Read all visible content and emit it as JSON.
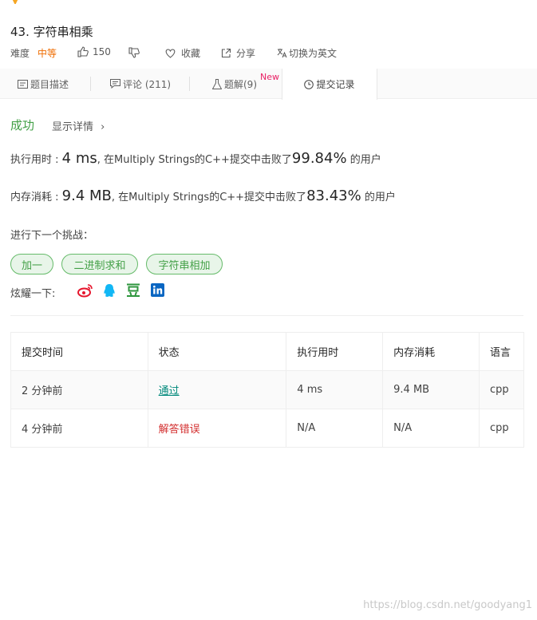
{
  "problem": {
    "title": "43. 字符串相乘"
  },
  "meta": {
    "difficulty_label": "难度",
    "difficulty": "中等",
    "likes": "150",
    "favorite_label": "收藏",
    "share_label": "分享",
    "switch_lang_label": "切换为英文"
  },
  "tabs": [
    {
      "label": "题目描述"
    },
    {
      "label": "评论 (211)"
    },
    {
      "label": "题解(9)",
      "badge": "New"
    },
    {
      "label": "提交记录"
    }
  ],
  "result": {
    "status": "成功",
    "detail_label": "显示详情",
    "runtime_prefix": "执行用时 : ",
    "runtime_value": "4 ms",
    "runtime_mid": ", 在Multiply Strings的C++提交中击败了",
    "runtime_percent": "99.84%",
    "runtime_suffix": " 的用户",
    "memory_prefix": "内存消耗 : ",
    "memory_value": "9.4 MB",
    "memory_mid": ", 在Multiply Strings的C++提交中击败了",
    "memory_percent": "83.43%",
    "memory_suffix": " 的用户"
  },
  "next_challenge": {
    "label": "进行下一个挑战：",
    "items": [
      "加一",
      "二进制求和",
      "字符串相加"
    ]
  },
  "share": {
    "label": "炫耀一下:",
    "icons": [
      "weibo-icon",
      "qq-icon",
      "douban-icon",
      "linkedin-icon"
    ]
  },
  "submissions": {
    "headers": [
      "提交时间",
      "状态",
      "执行用时",
      "内存消耗",
      "语言"
    ],
    "rows": [
      {
        "time": "2 分钟前",
        "status": "通过",
        "runtime": "4 ms",
        "memory": "9.4 MB",
        "lang": "cpp"
      },
      {
        "time": "4 分钟前",
        "status": "解答错误",
        "runtime": "N/A",
        "memory": "N/A",
        "lang": "cpp"
      }
    ]
  },
  "watermark": "https://blog.csdn.net/goodyang1",
  "colors": {
    "success": "#43a047",
    "difficulty_medium": "#ef6c00",
    "pass": "#00897b",
    "fail": "#d32f2f",
    "new_badge": "#e91e63"
  }
}
